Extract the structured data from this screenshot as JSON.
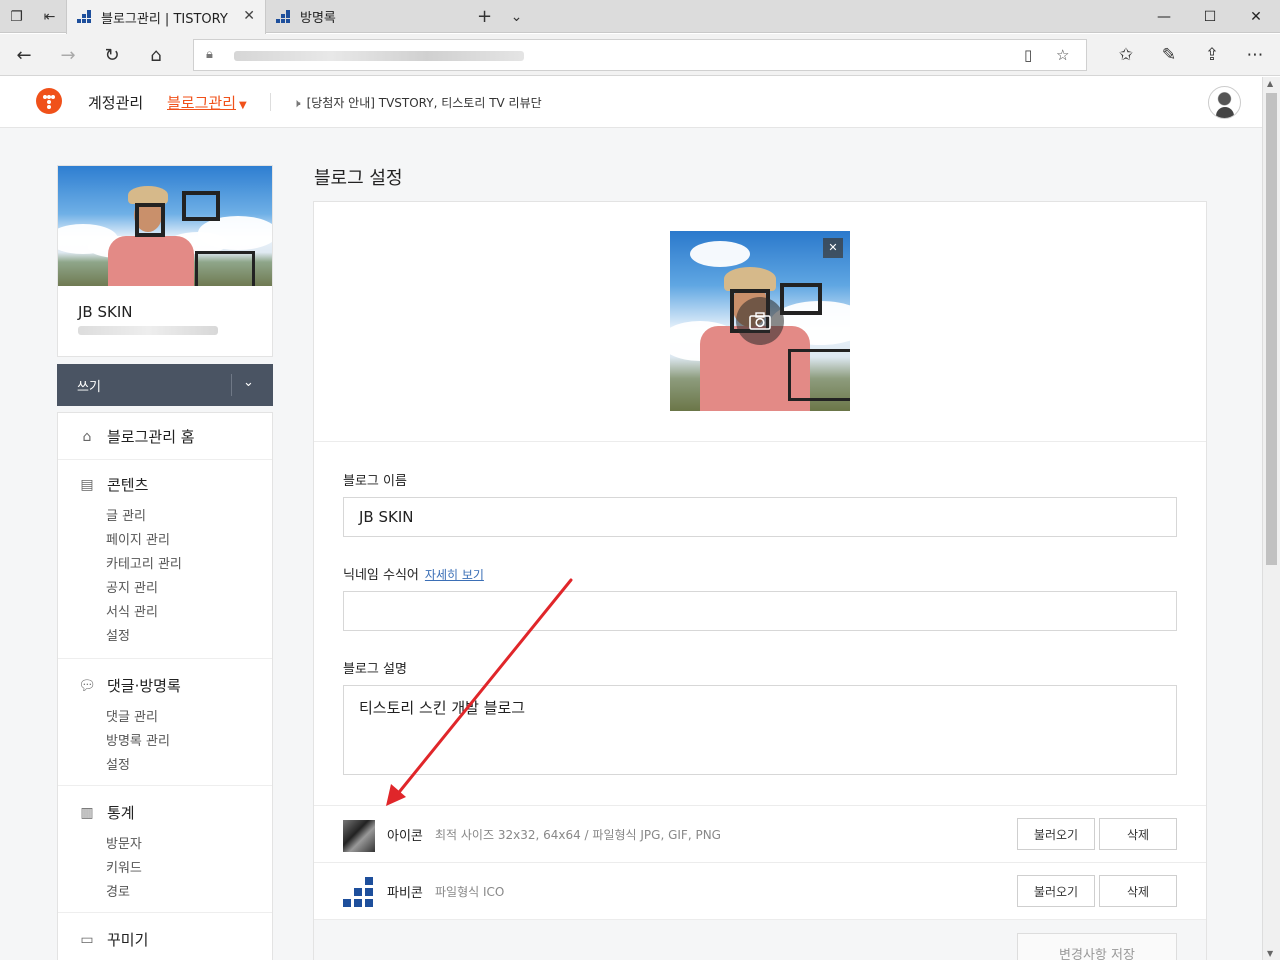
{
  "browser": {
    "tabs": [
      {
        "title": "블로그관리 | TISTORY",
        "active": true
      },
      {
        "title": "방명록",
        "active": false
      }
    ],
    "window_controls": {
      "minimize": "—",
      "maximize": "☐",
      "close": "✕"
    }
  },
  "header": {
    "menu_account": "계정관리",
    "menu_blog": "블로그관리",
    "notice": "[당첨자 안내] TVSTORY, 티스토리 TV 리뷰단"
  },
  "sidebar": {
    "blog_name": "JB SKIN",
    "write_label": "쓰기",
    "home": "블로그관리 홈",
    "sections": [
      {
        "title": "콘텐츠",
        "items": [
          "글 관리",
          "페이지 관리",
          "카테고리 관리",
          "공지 관리",
          "서식 관리",
          "설정"
        ]
      },
      {
        "title": "댓글·방명록",
        "items": [
          "댓글 관리",
          "방명록 관리",
          "설정"
        ]
      },
      {
        "title": "통계",
        "items": [
          "방문자",
          "키워드",
          "경로"
        ]
      },
      {
        "title": "꾸미기",
        "items": []
      }
    ]
  },
  "main": {
    "title": "블로그 설정",
    "blog_name_label": "블로그 이름",
    "blog_name_value": "JB SKIN",
    "nickname_label": "닉네임 수식어",
    "nickname_link": "자세히 보기",
    "nickname_value": "",
    "desc_label": "블로그 설명",
    "desc_value": "티스토리 스킨 개발 블로그",
    "icon_label": "아이콘",
    "icon_hint": "최적 사이즈 32x32, 64x64 / 파일형식 JPG, GIF, PNG",
    "favicon_label": "파비콘",
    "favicon_hint": "파일형식 ICO",
    "load_button": "불러오기",
    "delete_button": "삭제",
    "save_button": "변경사항 저장"
  },
  "colors": {
    "brand_orange": "#f0511a",
    "write_button_bg": "#4a5463",
    "arrow_red": "#e0262a",
    "link_blue": "#3b6fb6"
  },
  "icons": [
    "tab-actions-icon",
    "set-aside-icon",
    "tistory-icon",
    "new-tab-icon",
    "back-icon",
    "forward-icon",
    "refresh-icon",
    "home-icon",
    "lock-icon",
    "reading-view-icon",
    "favorite-star-icon",
    "favorites-icon",
    "pen-icon",
    "share-icon",
    "more-icon",
    "speaker-icon",
    "camera-icon",
    "chevron-down-icon"
  ]
}
